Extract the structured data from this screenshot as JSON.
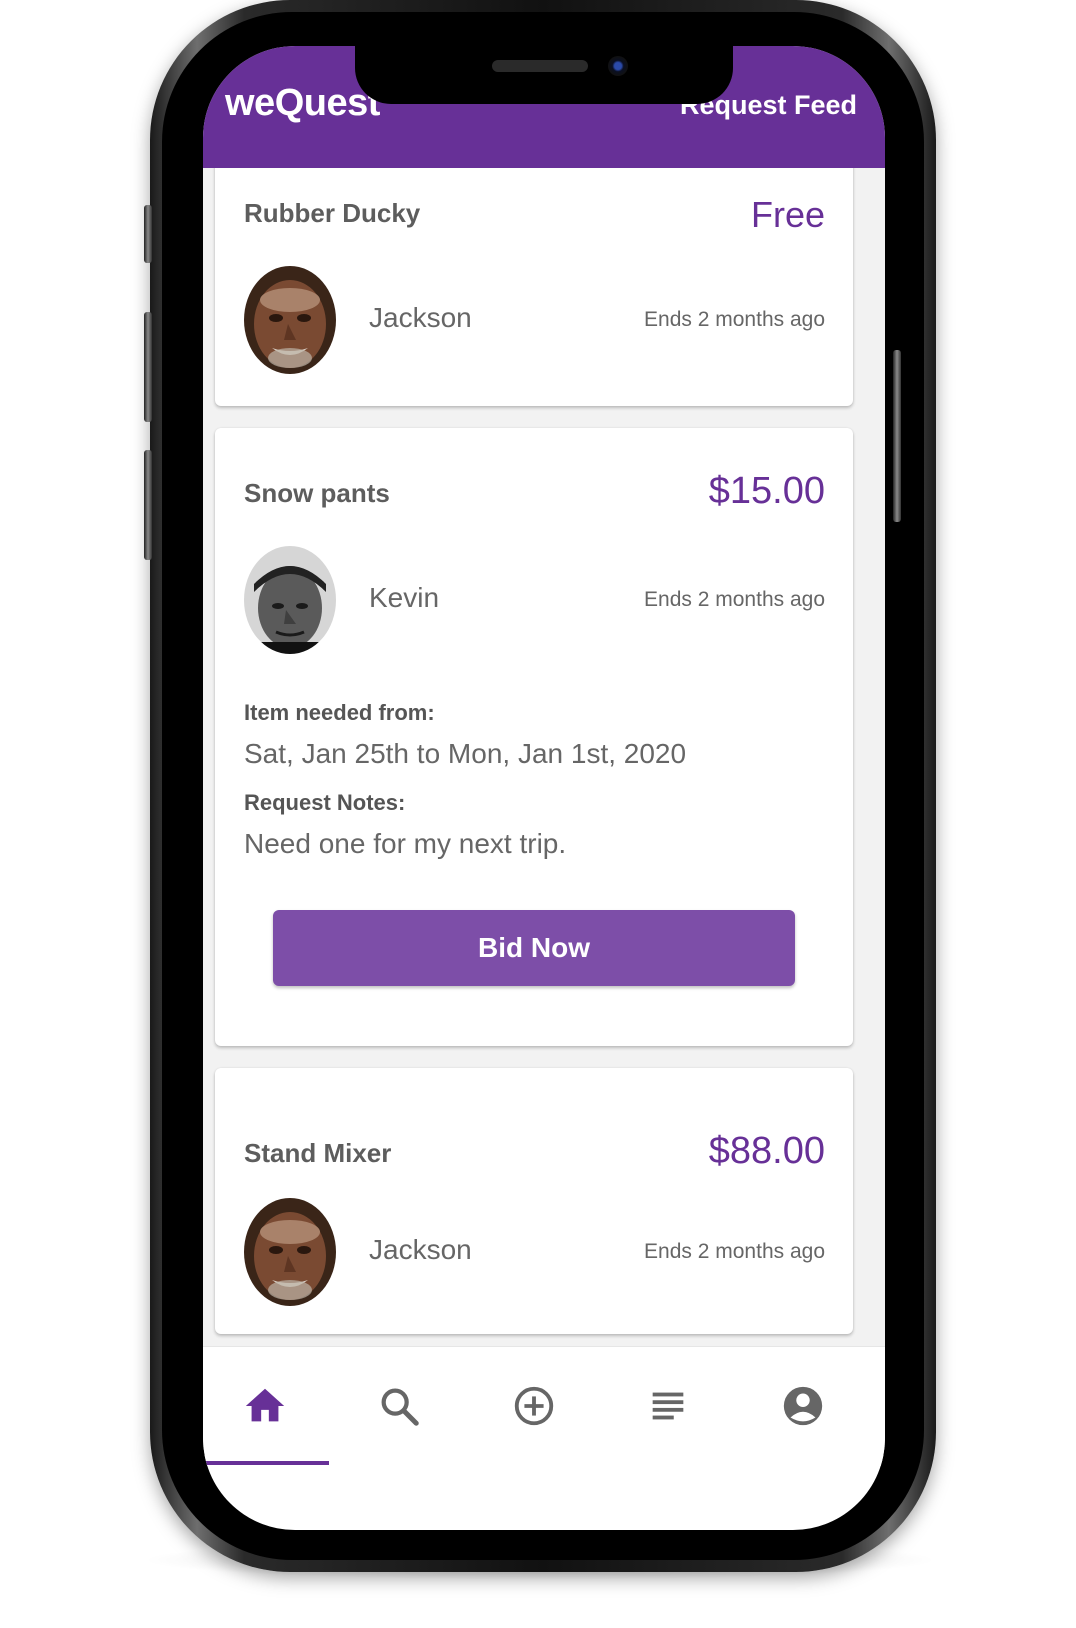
{
  "app": {
    "title": "weQuest",
    "section": "Request Feed",
    "accent_color": "#673097"
  },
  "requests": [
    {
      "item": "Rubber Ducky",
      "price": "Free",
      "user": "Jackson",
      "ends": "Ends 2 months ago",
      "avatar": "elderly-man-portrait"
    },
    {
      "item": "Snow pants",
      "price": "$15.00",
      "user": "Kevin",
      "ends": "Ends 2 months ago",
      "avatar": "man-in-beanie-portrait",
      "needed_label": "Item needed from:",
      "needed_dates": "Sat, Jan 25th to Mon, Jan 1st, 2020",
      "notes_label": "Request Notes:",
      "notes": "Need one for my next trip.",
      "action_label": "Bid Now"
    },
    {
      "item": "Stand Mixer",
      "price": "$88.00",
      "user": "Jackson",
      "ends": "Ends 2 months ago",
      "avatar": "elderly-man-portrait"
    }
  ],
  "bottom_nav": {
    "items": [
      "home-icon",
      "search-icon",
      "add-circle-icon",
      "list-icon",
      "account-icon"
    ],
    "active": "home-icon"
  }
}
